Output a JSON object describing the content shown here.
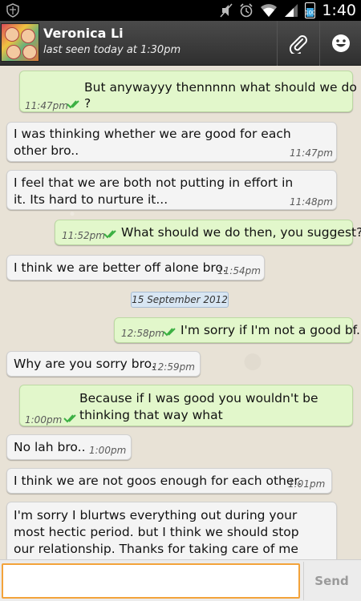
{
  "status_bar": {
    "time": "1:40",
    "battery_level": "100",
    "icons": [
      "shield-icon",
      "mute-icon",
      "alarm-icon",
      "wifi-icon",
      "signal-icon",
      "battery-icon"
    ]
  },
  "header": {
    "contact_name": "Veronica Li",
    "last_seen": "last seen today at 1:30pm",
    "attach_icon": "paperclip-icon",
    "emoji_icon": "smiley-icon"
  },
  "messages": [
    {
      "direction": "out",
      "text1": "But anywayyy thennnnn what should we do",
      "text2": "?",
      "time": "11:47pm",
      "delivered": true
    },
    {
      "direction": "in",
      "text1": "I was thinking whether we are good for each",
      "text2": "other bro..",
      "time": "11:47pm"
    },
    {
      "direction": "in",
      "text1": "I feel that we are both not putting in effort in",
      "text2": "it. Its hard to nurture it...",
      "time": "11:48pm"
    },
    {
      "direction": "out",
      "text1": "What should we do then, you suggest?",
      "time": "11:52pm",
      "delivered": true
    },
    {
      "direction": "in",
      "text1": "I think we are better off alone bro.",
      "time": "11:54pm"
    },
    {
      "direction": "out",
      "text1": "I'm sorry if I'm not a good bf.",
      "time": "12:58pm",
      "delivered": true
    },
    {
      "direction": "in",
      "text1": "Why are you sorry bro.",
      "time": "12:59pm"
    },
    {
      "direction": "out",
      "text1": "Because if I was good you wouldn't be",
      "text2": "thinking that way what",
      "time": "1:00pm",
      "delivered": true
    },
    {
      "direction": "in",
      "text1": "No lah bro..",
      "time": "1:00pm"
    },
    {
      "direction": "in",
      "text1": "I think we are not goos enough for each other.",
      "time": "1:01pm"
    },
    {
      "direction": "in",
      "text1": "I'm sorry I blurtws everything out during your",
      "text2": "most hectic period. but I think we should stop",
      "text3": "our relationship. Thanks for taking care of me"
    }
  ],
  "date_divider": "15 September 2012",
  "compose": {
    "placeholder": "",
    "value": "",
    "send_label": "Send"
  },
  "colors": {
    "incoming_bubble": "#f4f4f4",
    "outgoing_bubble": "#e2f7cb",
    "check_green": "#3cb043",
    "compose_focus": "#f3a33a"
  }
}
